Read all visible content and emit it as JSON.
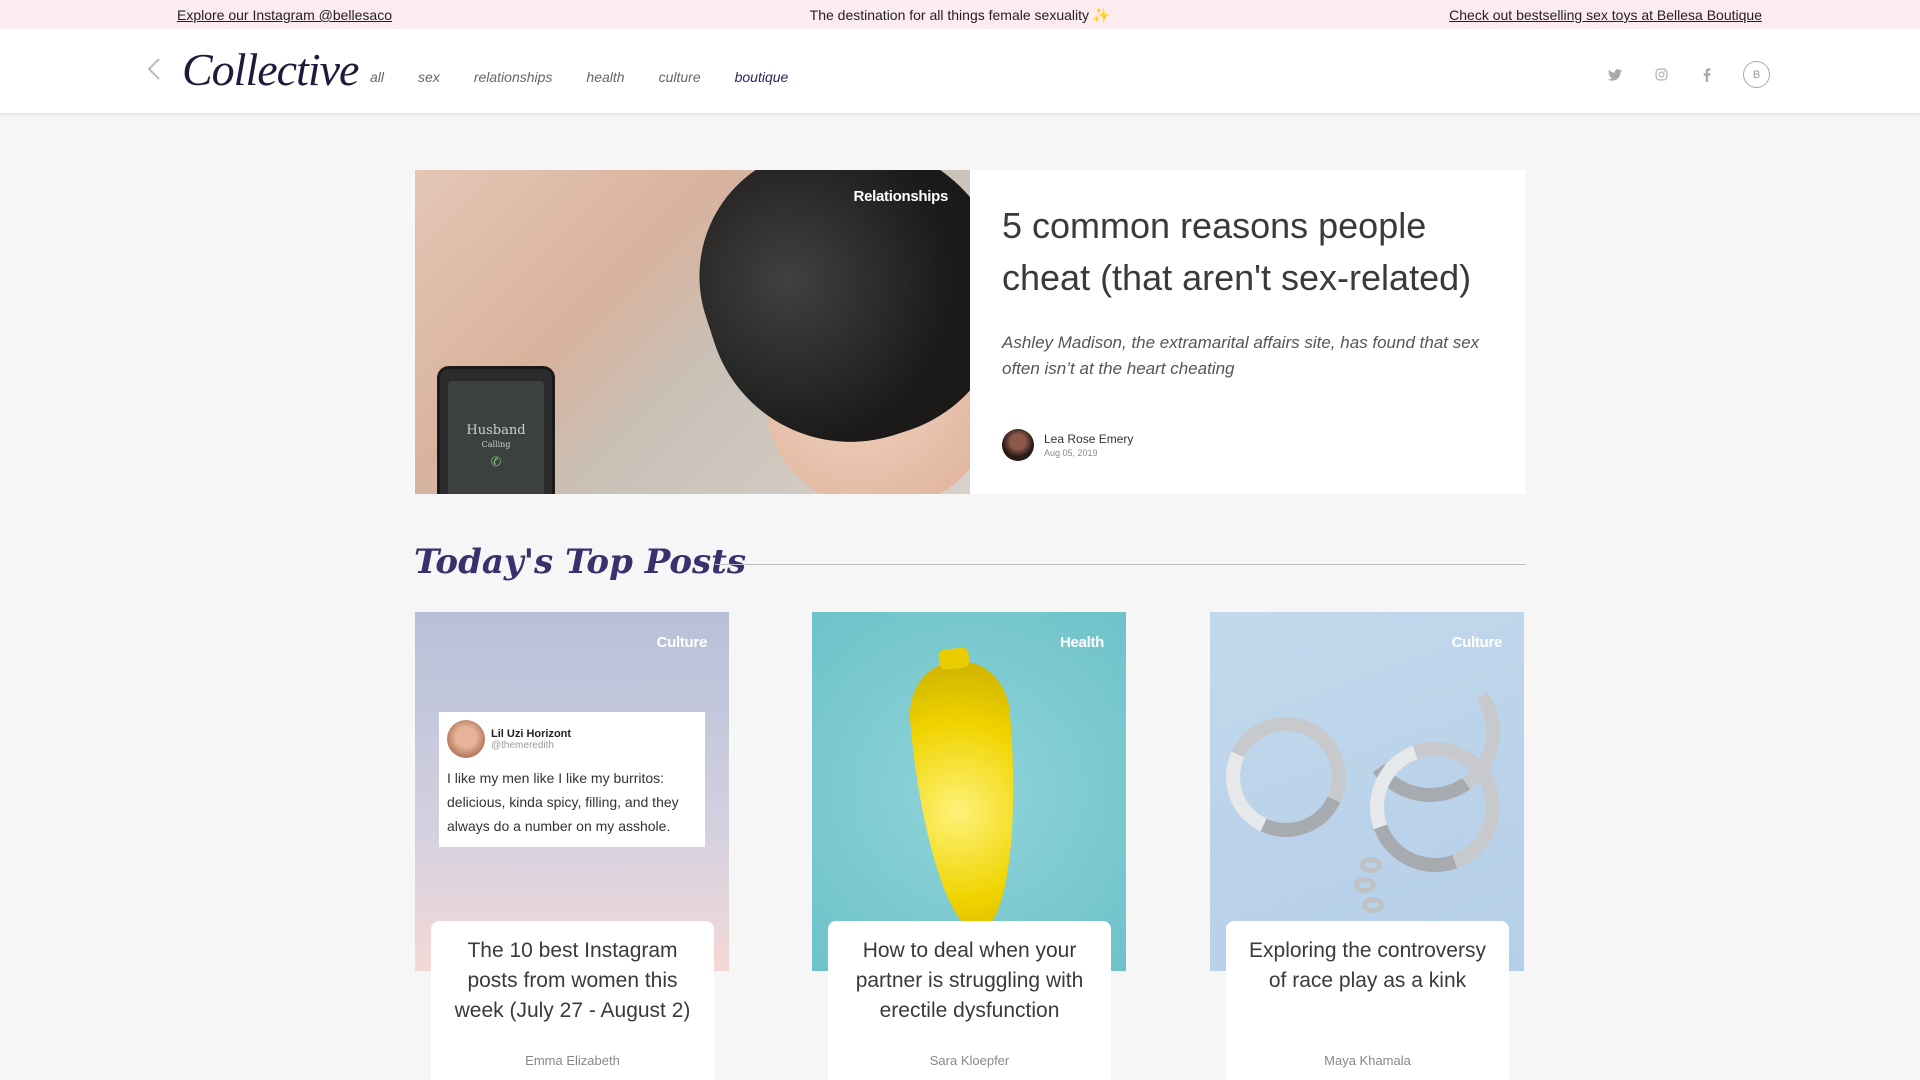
{
  "promo": {
    "left_link": "Explore our Instagram @bellesaco",
    "center": "The destination for all things female sexuality",
    "right_link": "Check out bestselling sex toys at Bellesa Boutique"
  },
  "header": {
    "logo": "Collective",
    "nav": [
      "all",
      "sex",
      "relationships",
      "health",
      "culture",
      "boutique"
    ],
    "active_nav": "boutique",
    "social_icons": [
      "twitter-icon",
      "instagram-icon",
      "facebook-icon",
      "bellesa-b-icon"
    ],
    "bellesa_letter": "B"
  },
  "hero": {
    "tag": "Relationships",
    "title": "5 common reasons people cheat (that aren't sex-related)",
    "subtitle": "Ashley Madison, the extramarital affairs site, has found that sex often isn’t at the heart cheating",
    "author": "Lea Rose Emery",
    "date": "Aug 05, 2019",
    "phone_text": "Husband",
    "phone_sub": "Calling"
  },
  "section": {
    "title": "Today's Top Posts"
  },
  "cards": [
    {
      "tag": "Culture",
      "title": "The 10 best Instagram posts from women this week (July 27 - August 2)",
      "author": "Emma Elizabeth",
      "tweet": {
        "name": "Lil Uzi Horizont",
        "handle": "@themeredith",
        "text": "I like my men like I like my burritos: delicious, kinda spicy, filling, and they always do a number on my asshole."
      }
    },
    {
      "tag": "Health",
      "title": "How to deal when your partner is struggling with erectile dysfunction",
      "author": "Sara Kloepfer"
    },
    {
      "tag": "Culture",
      "title": "Exploring the controversy of race play as a kink",
      "author": "Maya Khamala"
    }
  ],
  "colors": {
    "promo_bg": "#fdecef",
    "brand_navy": "#1e1a3c",
    "section_title": "#3b2f6d",
    "page_bg": "#f6f6f6"
  }
}
